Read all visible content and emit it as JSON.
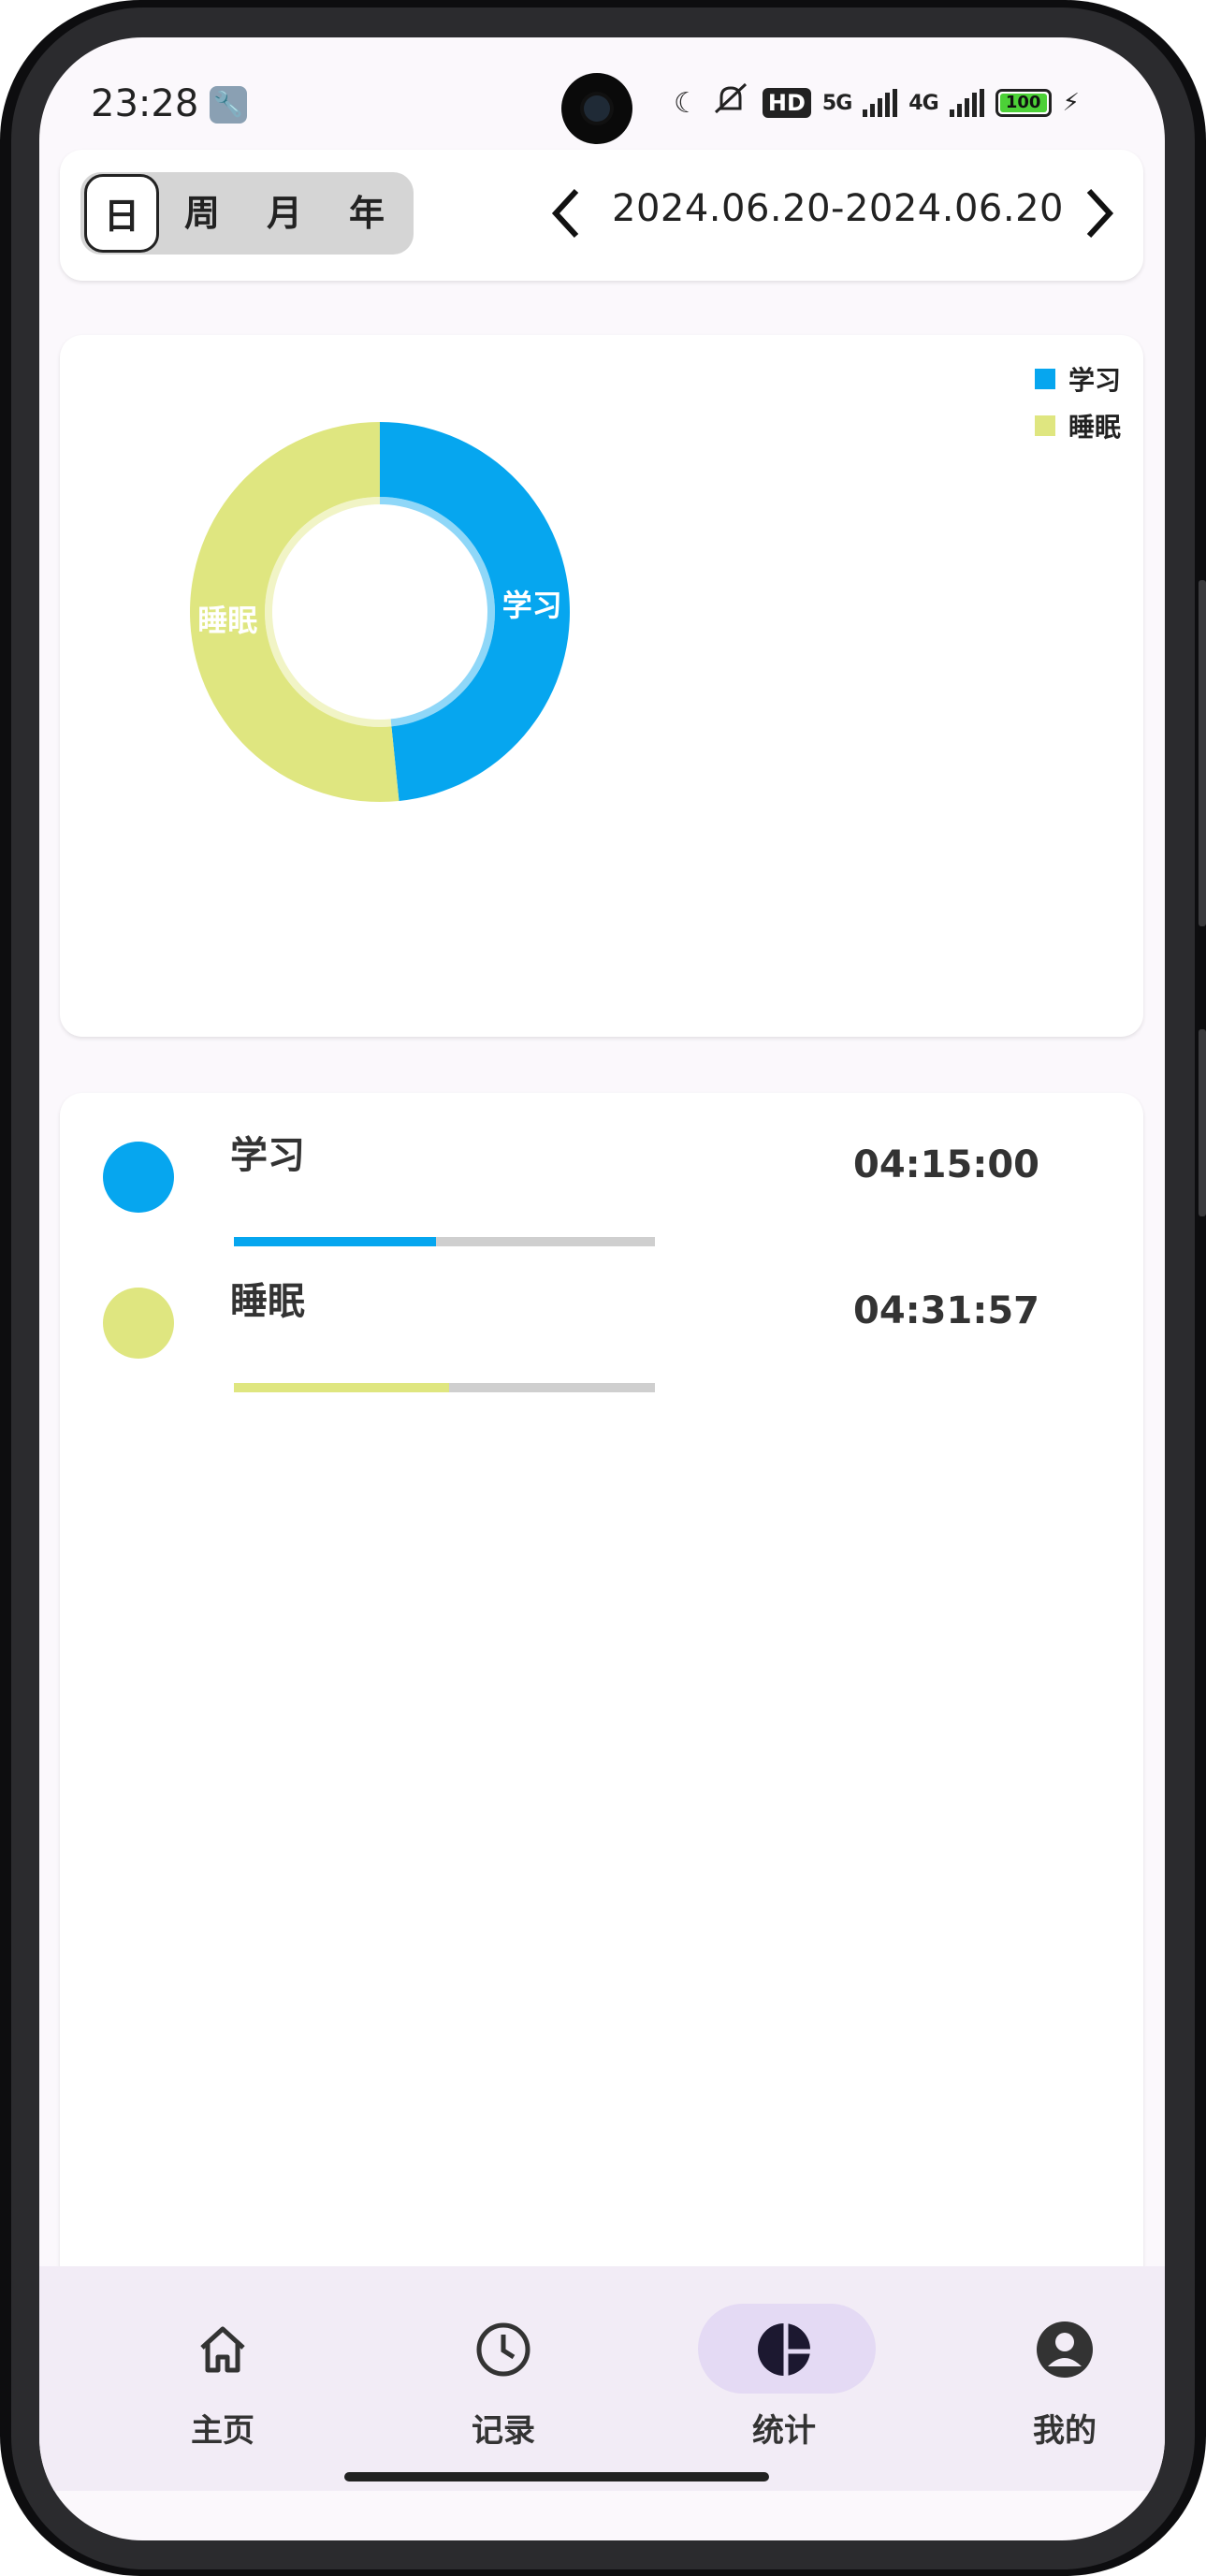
{
  "status_bar": {
    "time": "23:28",
    "signal_5g": "5G",
    "signal_4g": "4G",
    "hd_label": "HD",
    "battery_level": "100",
    "battery_fraction": 1.0
  },
  "period_selector": {
    "options": [
      "日",
      "周",
      "月",
      "年"
    ],
    "selected": "日"
  },
  "date_range": "2024.06.20-2024.06.20",
  "chart_data": {
    "type": "pie",
    "donut": true,
    "categories": [
      "学习",
      "睡眠"
    ],
    "values": [
      15300,
      16317
    ],
    "colors": [
      "#06a6ef",
      "#dfe680"
    ],
    "slice_labels": [
      "学习",
      "睡眠"
    ],
    "legend": {
      "entries": [
        "学习",
        "睡眠"
      ],
      "placement": "top-right"
    }
  },
  "summary_list": [
    {
      "label": "学习",
      "duration": "04:15:00",
      "color": "#06a6ef",
      "fraction": 0.48
    },
    {
      "label": "睡眠",
      "duration": "04:31:57",
      "color": "#dfe680",
      "fraction": 0.51
    }
  ],
  "bottom_nav": {
    "items": [
      {
        "label": "主页",
        "icon": "home-icon"
      },
      {
        "label": "记录",
        "icon": "clock-icon"
      },
      {
        "label": "统计",
        "icon": "pie-chart-icon"
      },
      {
        "label": "我的",
        "icon": "account-icon"
      }
    ],
    "active": "统计",
    "active_pill_color": "#e4daf4"
  }
}
